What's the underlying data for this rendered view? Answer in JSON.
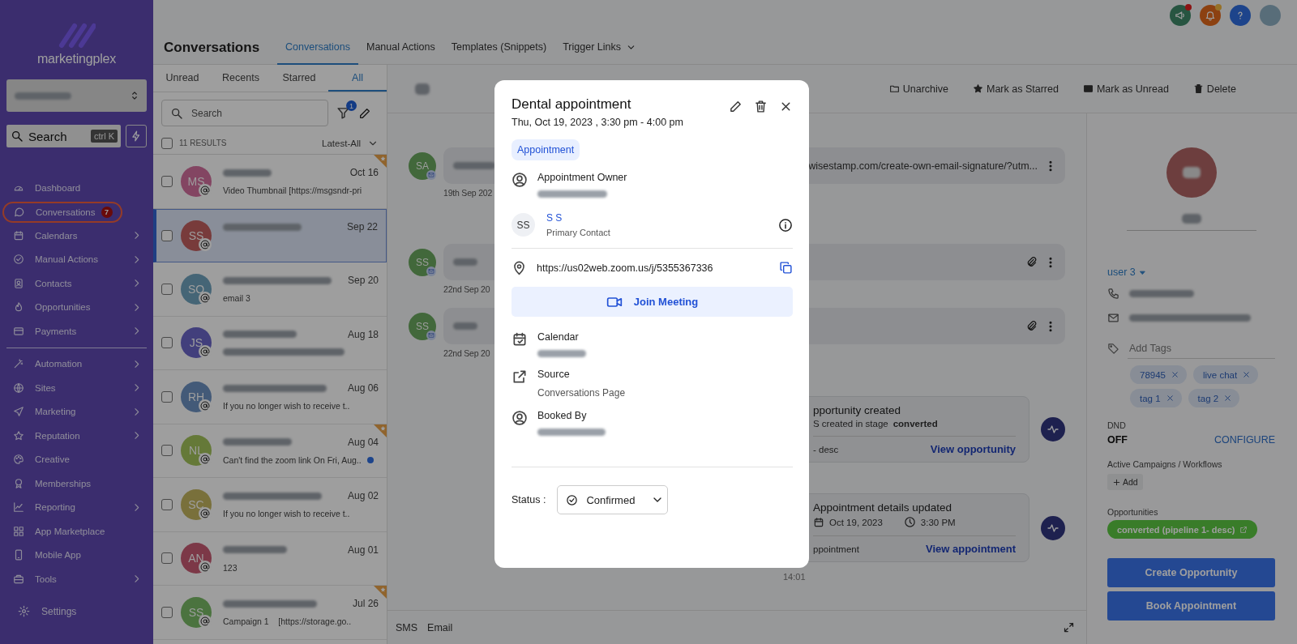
{
  "sidebar": {
    "logo": "marketingplex",
    "search": {
      "placeholder": "Search",
      "shortcut": "ctrl K"
    },
    "groups": [
      [
        {
          "label": "Dashboard",
          "chevron": false,
          "circled": false
        },
        {
          "label": "Conversations",
          "chevron": false,
          "circled": true,
          "badge": "7"
        },
        {
          "label": "Calendars",
          "chevron": true,
          "circled": false
        },
        {
          "label": "Manual Actions",
          "chevron": true,
          "circled": false
        },
        {
          "label": "Contacts",
          "chevron": true,
          "circled": false
        },
        {
          "label": "Opportunities",
          "chevron": true,
          "circled": false
        },
        {
          "label": "Payments",
          "chevron": true,
          "circled": false
        }
      ],
      [
        {
          "label": "Automation",
          "chevron": true,
          "circled": false
        },
        {
          "label": "Sites",
          "chevron": true,
          "circled": false
        },
        {
          "label": "Marketing",
          "chevron": true,
          "circled": false
        },
        {
          "label": "Reputation",
          "chevron": true,
          "circled": false
        },
        {
          "label": "Creative",
          "chevron": false,
          "circled": false
        },
        {
          "label": "Memberships",
          "chevron": false,
          "circled": false
        },
        {
          "label": "Reporting",
          "chevron": true,
          "circled": false
        },
        {
          "label": "App Marketplace",
          "chevron": false,
          "circled": false
        },
        {
          "label": "Mobile App",
          "chevron": false,
          "circled": false
        },
        {
          "label": "Tools",
          "chevron": true,
          "circled": false
        }
      ]
    ],
    "settings": "Settings"
  },
  "header": {
    "title": "Conversations",
    "tabs": [
      {
        "label": "Conversations",
        "selected": true,
        "dropdown": false
      },
      {
        "label": "Manual Actions",
        "selected": false,
        "dropdown": false
      },
      {
        "label": "Templates (Snippets)",
        "selected": false,
        "dropdown": false
      },
      {
        "label": "Trigger Links",
        "selected": false,
        "dropdown": true
      }
    ]
  },
  "list": {
    "filters": [
      {
        "label": "Unread",
        "selected": false
      },
      {
        "label": "Recents",
        "selected": false
      },
      {
        "label": "Starred",
        "selected": false
      },
      {
        "label": "All",
        "selected": true
      }
    ],
    "search": {
      "placeholder": "Search"
    },
    "select_all": {
      "checked": false
    },
    "filter_count": "1",
    "results": "11 RESULTS",
    "sort": "Latest-All",
    "conversations": [
      {
        "initials": "MS",
        "color": "#834562",
        "date": "Oct 16",
        "preview": "Video Thumbnail [https://msgsndr-pri",
        "checked": false,
        "selected": false,
        "starred": true,
        "unread": false
      },
      {
        "initials": "SS",
        "color": "#783b3b",
        "date": "Sep 22",
        "checked": false,
        "selected": true,
        "starred": false,
        "unread": false
      },
      {
        "initials": "SO",
        "color": "#456576",
        "date": "Sep 20",
        "preview": "email 3",
        "checked": false,
        "selected": false,
        "starred": false,
        "unread": false
      },
      {
        "initials": "JS",
        "color": "#423f7c",
        "date": "Aug 18",
        "blurred_preview": true,
        "checked": false,
        "selected": false,
        "starred": false,
        "unread": false
      },
      {
        "initials": "RH",
        "color": "#435a78",
        "date": "Aug 06",
        "preview": "If you no longer wish to receive t..",
        "checked": false,
        "selected": false,
        "starred": false,
        "unread": false
      },
      {
        "initials": "NL",
        "color": "#657938",
        "date": "Aug 04",
        "preview": "Can't find the zoom link On Fri, Aug..",
        "checked": false,
        "selected": false,
        "starred": true,
        "unread": true
      },
      {
        "initials": "SC",
        "color": "#79703b",
        "date": "Aug 02",
        "preview": "If you no longer wish to receive t..",
        "checked": false,
        "selected": false,
        "starred": false,
        "unread": false
      },
      {
        "initials": "AN",
        "color": "#7c3847",
        "date": "Aug 01",
        "preview": "123",
        "checked": false,
        "selected": false,
        "starred": false,
        "unread": false
      },
      {
        "initials": "SS",
        "color": "#4b733f",
        "date": "Jul 26",
        "preview": "Campaign 1    [https://storage.go..",
        "checked": false,
        "selected": false,
        "starred": true,
        "unread": false
      }
    ]
  },
  "conversation": {
    "actions": [
      "Unarchive",
      "Mark as Starred",
      "Mark as Unread",
      "Delete"
    ],
    "messages": [
      {
        "initials": "SA",
        "color": "#42683b",
        "text": "wisestamp.com/create-own-email-signature/?utm...",
        "attachment": false,
        "time": "19th Sep 202"
      },
      {
        "initials": "SS",
        "color": "#42683b",
        "attachment": true,
        "time": "22nd Sep 20"
      },
      {
        "initials": "SS",
        "color": "#42683b",
        "attachment": true,
        "time": "22nd Sep 20"
      }
    ],
    "activities": [
      {
        "kind": "opportunity",
        "title": "pportunity created",
        "detail": "S created in stage **converted**",
        "footer": "- desc",
        "link": "View opportunity"
      },
      {
        "kind": "appointment",
        "title": "Appointment details updated",
        "date": "Oct 19, 2023",
        "time": "3:30 PM",
        "footer": "ppointment",
        "link": "View appointment"
      }
    ],
    "last_time": "14:01",
    "channels": [
      "SMS",
      "Email"
    ]
  },
  "contact": {
    "owner": "user 3",
    "tags_placeholder": "Add Tags",
    "tags": [
      "78945",
      "live chat",
      "tag 1",
      "tag 2"
    ],
    "dnd_label": "DND",
    "dnd_value": "OFF",
    "configure": "CONFIGURE",
    "campaigns_label": "Active Campaigns / Workflows",
    "add": "Add",
    "opportunities_label": "Opportunities",
    "opportunity": "converted (pipeline 1- desc)",
    "buttons": [
      "Create Opportunity",
      "Book Appointment"
    ]
  },
  "modal": {
    "title": "Dental appointment",
    "when": "Thu, Oct 19, 2023 , 3:30 pm - 4:00 pm",
    "type": "Appointment",
    "owner_label": "Appointment Owner",
    "contact": {
      "initials": "SS",
      "name": "S S",
      "role": "Primary Contact"
    },
    "location": "https://us02web.zoom.us/j/5355367336",
    "join": "Join Meeting",
    "calendar_label": "Calendar",
    "source_label": "Source",
    "source": "Conversations Page",
    "booked_by_label": "Booked By",
    "status_label": "Status :",
    "status": "Confirmed"
  }
}
